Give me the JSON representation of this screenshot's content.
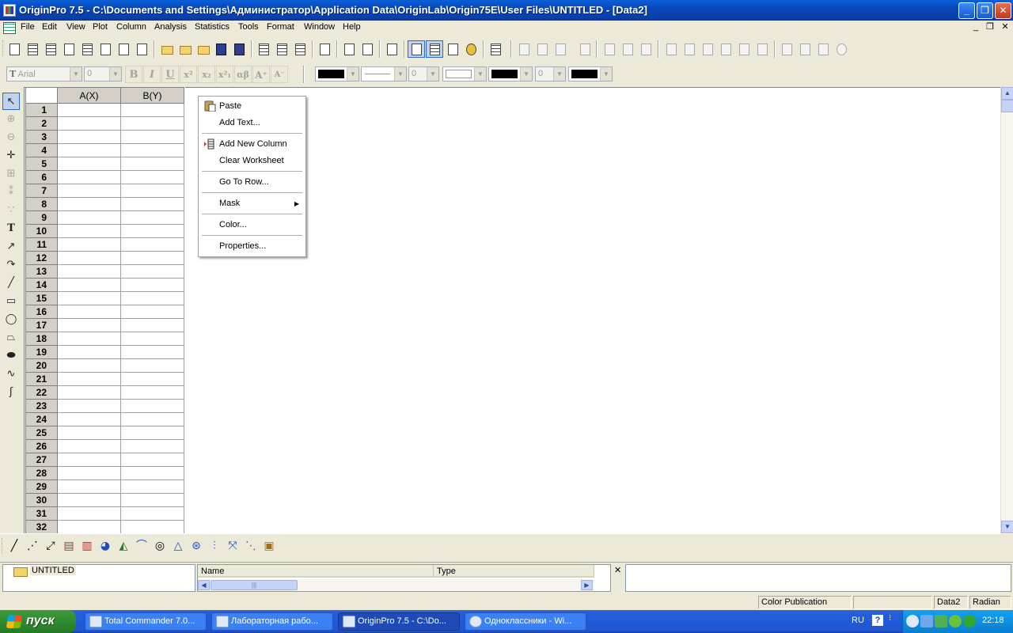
{
  "window": {
    "title": "OriginPro 7.5 - C:\\Documents and Settings\\Администратор\\Application Data\\OriginLab\\Origin75E\\User Files\\UNTITLED - [Data2]",
    "minimize": "_",
    "restore": "❐",
    "close": "✕"
  },
  "menu": {
    "items": [
      "File",
      "Edit",
      "View",
      "Plot",
      "Column",
      "Analysis",
      "Statistics",
      "Tools",
      "Format",
      "Window",
      "Help"
    ],
    "mdi_minimize": "_",
    "mdi_restore": "❐",
    "mdi_close": "✕"
  },
  "format_toolbar": {
    "font_name": "Arial",
    "font_size": "0",
    "line_width": "0",
    "symbol_size": "0",
    "bold_label": "B",
    "italic_label": "I",
    "underline_label": "U",
    "superscript_label": "x²",
    "subscript_label": "x₂",
    "supsub_label": "x²₁",
    "greek_label": "αβ",
    "enlarge_label": "A⁺",
    "reduce_label": "A⁻"
  },
  "worksheet": {
    "columns": [
      "A(X)",
      "B(Y)"
    ],
    "rows": [
      "1",
      "2",
      "3",
      "4",
      "5",
      "6",
      "7",
      "8",
      "9",
      "10",
      "11",
      "12",
      "13",
      "14",
      "15",
      "16",
      "17",
      "18",
      "19",
      "20",
      "21",
      "22",
      "23",
      "24",
      "25",
      "26",
      "27",
      "28",
      "29",
      "30",
      "31",
      "32"
    ]
  },
  "context_menu": {
    "items": [
      {
        "label": "Paste",
        "icon": "paste-icon"
      },
      {
        "label": "Add Text..."
      },
      {
        "label": "Add New Column",
        "icon": "add-column-icon"
      },
      {
        "label": "Clear Worksheet"
      },
      {
        "label": "Go To Row..."
      },
      {
        "label": "Mask",
        "submenu": true
      },
      {
        "label": "Color..."
      },
      {
        "label": "Properties..."
      }
    ]
  },
  "project_explorer": {
    "folder": "UNTITLED",
    "list_headers": [
      "Name",
      "Type"
    ]
  },
  "status_bar": {
    "theme": "Color Publication",
    "active_window": "Data2",
    "angle_unit": "Radian"
  },
  "taskbar": {
    "start_label": "пуск",
    "tasks": [
      {
        "label": "Total Commander 7.0...",
        "active": false
      },
      {
        "label": "Лабораторная рабо...",
        "active": false
      },
      {
        "label": "OriginPro 7.5 - C:\\Do...",
        "active": true
      },
      {
        "label": "Одноклассники - Wi...",
        "active": false
      }
    ],
    "language": "RU",
    "clock": "22:18"
  },
  "colors": {
    "title_bar": "#0a5fd8",
    "taskbar": "#245edb",
    "start_button": "#2f8b2f",
    "tray": "#0e8fe0",
    "workspace": "#ffffff",
    "header_gray": "#d4d0c8"
  }
}
